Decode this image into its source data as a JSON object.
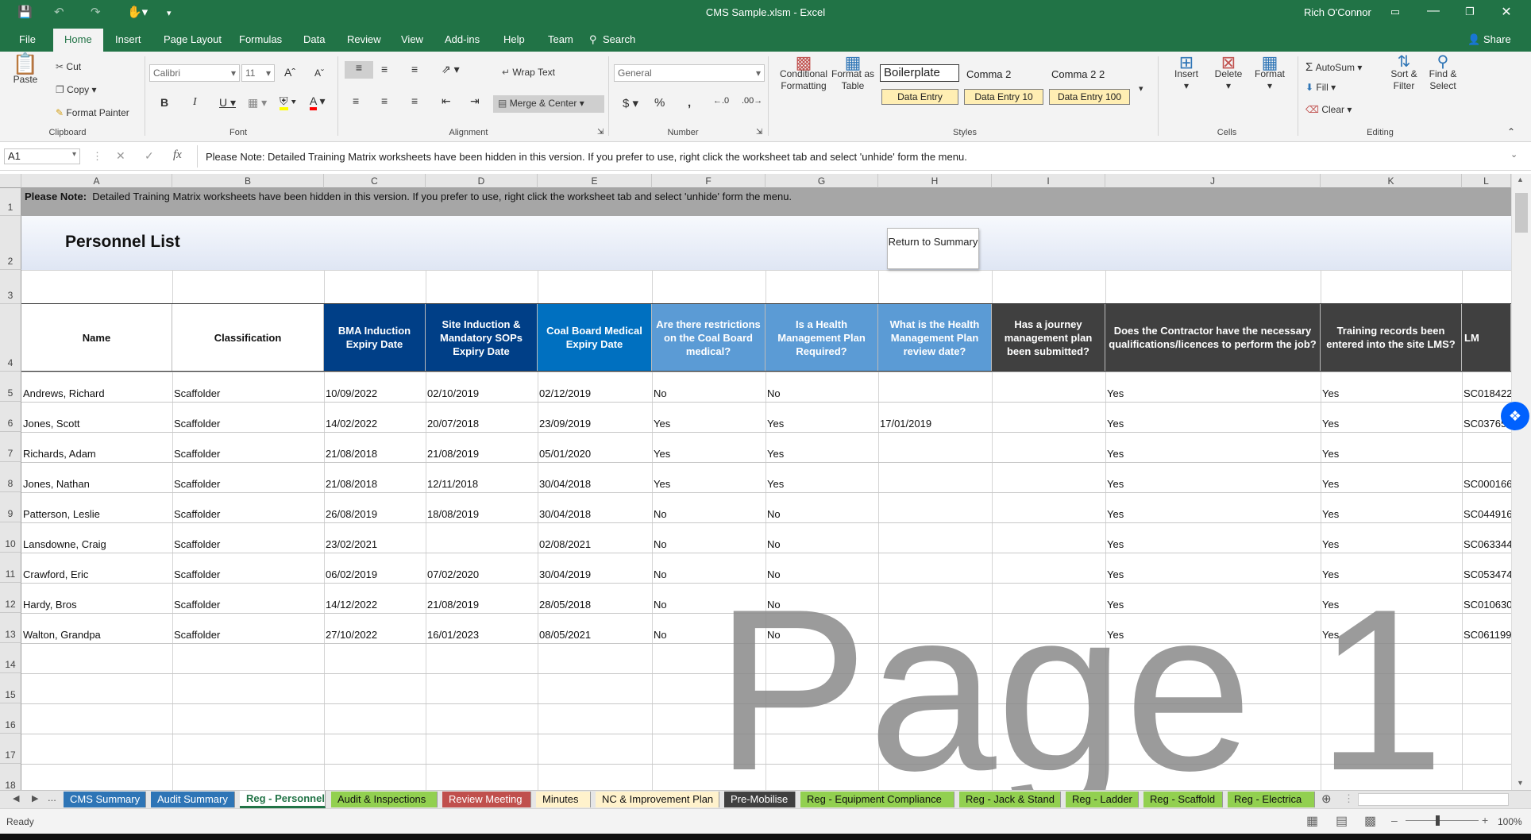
{
  "window": {
    "title": "CMS Sample.xlsm  -  Excel",
    "user": "Rich O'Connor"
  },
  "menu": {
    "tabs": [
      "File",
      "Home",
      "Insert",
      "Page Layout",
      "Formulas",
      "Data",
      "Review",
      "View",
      "Add-ins",
      "Help",
      "Team"
    ],
    "search": "Search",
    "share": "Share"
  },
  "ribbon": {
    "clipboard": {
      "paste": "Paste",
      "cut": "Cut",
      "copy": "Copy",
      "format_painter": "Format Painter",
      "label": "Clipboard"
    },
    "font": {
      "name": "Calibri",
      "size": "11",
      "label": "Font"
    },
    "alignment": {
      "wrap": "Wrap Text",
      "merge": "Merge & Center",
      "label": "Alignment"
    },
    "number": {
      "format": "General",
      "label": "Number"
    },
    "styles": {
      "conditional": "Conditional Formatting",
      "format_table": "Format as Table",
      "boilerplate": "Boilerplate",
      "comma2": "Comma 2",
      "comma22": "Comma 2 2",
      "de": "Data Entry",
      "de10": "Data Entry 10",
      "de100": "Data Entry 100",
      "label": "Styles"
    },
    "cells": {
      "insert": "Insert",
      "delete": "Delete",
      "format": "Format",
      "label": "Cells"
    },
    "editing": {
      "autosum": "AutoSum",
      "fill": "Fill",
      "clear": "Clear",
      "sort": "Sort & Filter",
      "find": "Find & Select",
      "label": "Editing"
    }
  },
  "formula_bar": {
    "name_box": "A1",
    "fx": "fx",
    "content": "Please Note:  Detailed Training Matrix worksheets have been hidden in this version.  If you prefer to use, right click the worksheet tab and select 'unhide' form the menu."
  },
  "columns": [
    "A",
    "B",
    "C",
    "D",
    "E",
    "F",
    "G",
    "H",
    "I",
    "J",
    "K",
    "L"
  ],
  "rows": [
    "1",
    "2",
    "3",
    "4",
    "5",
    "6",
    "7",
    "8",
    "9",
    "10",
    "11",
    "12",
    "13",
    "14",
    "15",
    "16",
    "17",
    "18"
  ],
  "note": {
    "bold": "Please Note:",
    "text": "Detailed Training Matrix worksheets have been hidden in this version.  If you prefer to use, right click the worksheet tab and select 'unhide' form the menu."
  },
  "title": "Personnel List",
  "return_button": "Return to Summary",
  "headers": [
    "Name",
    "Classification",
    "BMA Induction Expiry Date",
    "Site Induction & Mandatory SOPs Expiry Date",
    "Coal Board Medical Expiry Date",
    "Are there restrictions on the Coal Board medical?",
    "Is a Health Management Plan Required?",
    "What is the Health Management Plan review date?",
    "Has a journey management plan been submitted?",
    "Does the Contractor have the necessary qualifications/licences to perform the job?",
    "Training records been entered into the site LMS?",
    "LM"
  ],
  "records": [
    [
      "Andrews, Richard",
      "Scaffolder",
      "10/09/2022",
      "02/10/2019",
      "02/12/2019",
      "No",
      "No",
      "",
      "",
      "Yes",
      "Yes",
      "SC018422"
    ],
    [
      "Jones, Scott",
      "Scaffolder",
      "14/02/2022",
      "20/07/2018",
      "23/09/2019",
      "Yes",
      "Yes",
      "17/01/2019",
      "",
      "Yes",
      "Yes",
      "SC03765"
    ],
    [
      "Richards, Adam",
      "Scaffolder",
      "21/08/2018",
      "21/08/2019",
      "05/01/2020",
      "Yes",
      "Yes",
      "",
      "",
      "Yes",
      "Yes",
      ""
    ],
    [
      "Jones, Nathan",
      "Scaffolder",
      "21/08/2018",
      "12/11/2018",
      "30/04/2018",
      "Yes",
      "Yes",
      "",
      "",
      "Yes",
      "Yes",
      "SC000166"
    ],
    [
      "Patterson, Leslie",
      "Scaffolder",
      "26/08/2019",
      "18/08/2019",
      "30/04/2018",
      "No",
      "No",
      "",
      "",
      "Yes",
      "Yes",
      "SC044916"
    ],
    [
      "Lansdowne, Craig",
      "Scaffolder",
      "23/02/2021",
      "",
      "02/08/2021",
      "No",
      "No",
      "",
      "",
      "Yes",
      "Yes",
      "SC063344"
    ],
    [
      "Crawford, Eric",
      "Scaffolder",
      "06/02/2019",
      "07/02/2020",
      "30/04/2019",
      "No",
      "No",
      "",
      "",
      "Yes",
      "Yes",
      "SC053474"
    ],
    [
      "Hardy, Bros",
      "Scaffolder",
      "14/12/2022",
      "21/08/2019",
      "28/05/2018",
      "No",
      "No",
      "",
      "",
      "Yes",
      "Yes",
      "SC010630"
    ],
    [
      "Walton, Grandpa",
      "Scaffolder",
      "27/10/2022",
      "16/01/2023",
      "08/05/2021",
      "No",
      "No",
      "",
      "",
      "Yes",
      "Yes",
      "SC061199"
    ]
  ],
  "watermark": "Page 1",
  "sheets": [
    {
      "name": "CMS Summary",
      "bg": "#2e75b6",
      "fg": "#ffffff"
    },
    {
      "name": "Audit Summary",
      "bg": "#2e75b6",
      "fg": "#ffffff"
    },
    {
      "name": "Reg - Personnel",
      "bg": "#ffffff",
      "fg": "#217346"
    },
    {
      "name": "Audit & Inspections",
      "bg": "#92d050",
      "fg": "#111111"
    },
    {
      "name": "Review Meeting",
      "bg": "#c0504d",
      "fg": "#ffffff"
    },
    {
      "name": "Minutes",
      "bg": "#fff2cc",
      "fg": "#111111"
    },
    {
      "name": "NC & Improvement Plan",
      "bg": "#fff2cc",
      "fg": "#111111"
    },
    {
      "name": "Pre-Mobilise",
      "bg": "#404040",
      "fg": "#ffffff"
    },
    {
      "name": "Reg - Equipment Compliance",
      "bg": "#92d050",
      "fg": "#111111"
    },
    {
      "name": "Reg - Jack & Stand",
      "bg": "#92d050",
      "fg": "#111111"
    },
    {
      "name": "Reg - Ladder",
      "bg": "#92d050",
      "fg": "#111111"
    },
    {
      "name": "Reg - Scaffold",
      "bg": "#92d050",
      "fg": "#111111"
    },
    {
      "name": "Reg - Electrica",
      "bg": "#92d050",
      "fg": "#111111"
    }
  ],
  "status": {
    "ready": "Ready",
    "zoom": "100%"
  },
  "colors": {
    "excel_green": "#217346",
    "dark_blue": "#003f87",
    "blue": "#0070c0",
    "light_blue": "#5b9bd5",
    "mid_blue": "#4a90d9",
    "dark_grey": "#404040"
  }
}
